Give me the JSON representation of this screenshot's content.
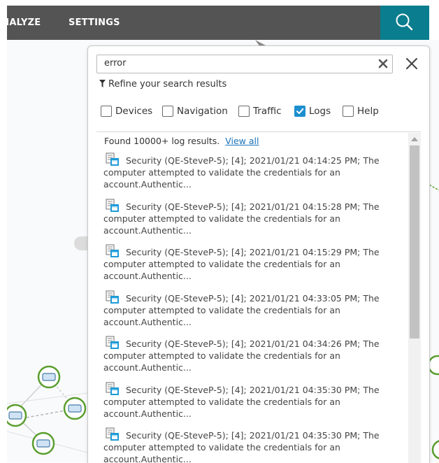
{
  "nav": {
    "analyze_label": "ANALYZE",
    "settings_label": "SETTINGS",
    "search_icon": "search-icon"
  },
  "search": {
    "value": "error",
    "placeholder": "",
    "clear_icon": "clear-icon",
    "close_icon": "close-icon"
  },
  "refine": {
    "label": "Refine your search results",
    "icon": "funnel-icon"
  },
  "filters": [
    {
      "label": "Devices",
      "checked": false
    },
    {
      "label": "Navigation",
      "checked": false
    },
    {
      "label": "Traffic",
      "checked": false
    },
    {
      "label": "Logs",
      "checked": true
    },
    {
      "label": "Help",
      "checked": false
    }
  ],
  "results": {
    "found_text": "Found 10000+ log results.",
    "view_all_label": "View all",
    "items": [
      {
        "text": "Security (QE-SteveP-5); [4]; 2021/01/21 04:14:25 PM; The computer attempted to validate the credentials for an account.Authentic..."
      },
      {
        "text": "Security (QE-SteveP-5); [4]; 2021/01/21 04:15:28 PM; The computer attempted to validate the credentials for an account.Authentic..."
      },
      {
        "text": "Security (QE-SteveP-5); [4]; 2021/01/21 04:15:29 PM; The computer attempted to validate the credentials for an account.Authentic..."
      },
      {
        "text": "Security (QE-SteveP-5); [4]; 2021/01/21 04:33:05 PM; The computer attempted to validate the credentials for an account.Authentic..."
      },
      {
        "text": "Security (QE-SteveP-5); [4]; 2021/01/21 04:34:26 PM; The computer attempted to validate the credentials for an account.Authentic..."
      },
      {
        "text": "Security (QE-SteveP-5); [4]; 2021/01/21 04:35:30 PM; The computer attempted to validate the credentials for an account.Authentic..."
      },
      {
        "text": "Security (QE-SteveP-5); [4]; 2021/01/21 04:35:30 PM; The computer attempted to validate the credentials for an account.Authentic..."
      }
    ]
  },
  "colors": {
    "topbar": "#545454",
    "search_button": "#0a7d8e",
    "checkbox_checked": "#1c8fcf",
    "link": "#1a73b8",
    "node_ring": "#5a9e2f"
  }
}
